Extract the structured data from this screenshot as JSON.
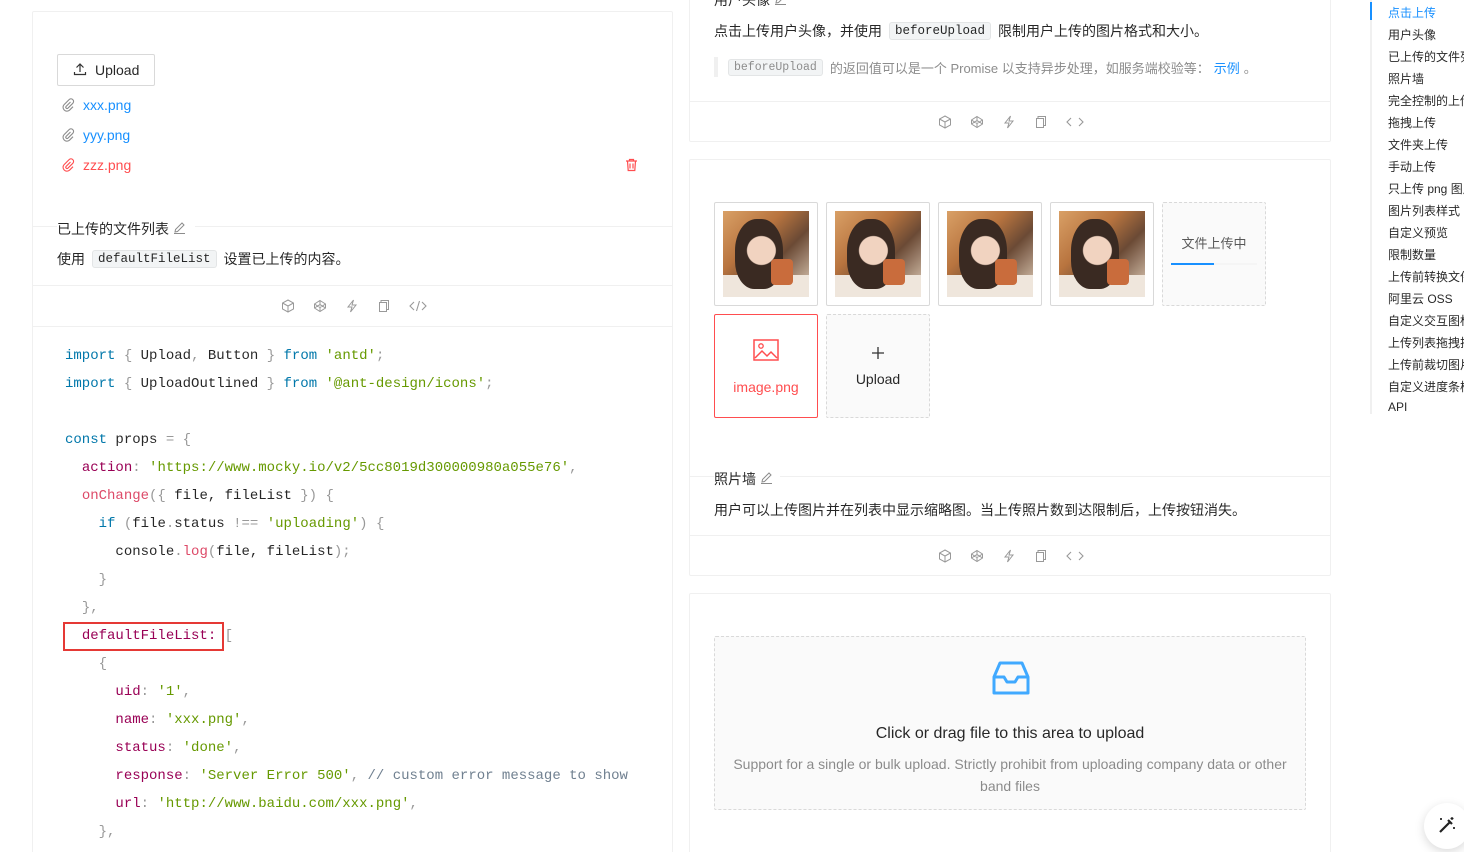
{
  "left_demo": {
    "upload_label": "Upload",
    "files": [
      {
        "name": "xxx.png",
        "status": "done"
      },
      {
        "name": "yyy.png",
        "status": "done"
      },
      {
        "name": "zzz.png",
        "status": "error"
      }
    ],
    "title": "已上传的文件列表",
    "desc_pre": "使用",
    "desc_code": "defaultFileList",
    "desc_post": "设置已上传的内容。"
  },
  "code": {
    "l1_kw": "import",
    "l1_mid": "Upload",
    "l1_mid2": "Button",
    "l1_from": "from",
    "l1_str": "'antd'",
    "l2_kw": "import",
    "l2_mid": "UploadOutlined",
    "l2_from": "from",
    "l2_str": "'@ant-design/icons'",
    "l4_kw": "const",
    "l4_name": "props",
    "action_key": "action",
    "action_val": "'https://www.mocky.io/v2/5cc8019d300000980a055e76'",
    "onchange_key": "onChange",
    "onchange_args": "file, fileList",
    "if_kw": "if",
    "if_cond_a": "file",
    "if_cond_b": "status",
    "if_str": "'uploading'",
    "console": "console",
    "log": "log",
    "log_args": "file, fileList",
    "dfl_key": "defaultFileList:",
    "uid_key": "uid",
    "uid_val": "'1'",
    "name_key": "name",
    "name_val": "'xxx.png'",
    "status_key": "status",
    "status_val": "'done'",
    "response_key": "response",
    "response_val": "'Server Error 500'",
    "response_comment": "// custom error message to show",
    "url_key": "url",
    "url_val": "'http://www.baidu.com/xxx.png'"
  },
  "avatar_demo": {
    "title": "用户头像",
    "desc_pre": "点击上传用户头像，并使用",
    "desc_code": "beforeUpload",
    "desc_post": "限制用户上传的图片格式和大小。",
    "note_code": "beforeUpload",
    "note_text": "的返回值可以是一个 Promise 以支持异步处理，如服务端校验等：",
    "note_link": "示例",
    "note_end": "。"
  },
  "picture_wall": {
    "uploading_label": "文件上传中",
    "error_file": "image.png",
    "upload_label": "Upload",
    "title": "照片墙",
    "desc": "用户可以上传图片并在列表中显示缩略图。当上传照片数到达限制后，上传按钮消失。"
  },
  "dragger": {
    "text": "Click or drag file to this area to upload",
    "hint_line1": "Support for a single or bulk upload. Strictly prohibit from uploading company data or other",
    "hint_line2": "band files"
  },
  "anchor": {
    "items": [
      "点击上传",
      "用户头像",
      "已上传的文件列表",
      "照片墙",
      "完全控制的上传列表",
      "拖拽上传",
      "文件夹上传",
      "手动上传",
      "只上传 png 图片",
      "图片列表样式",
      "自定义预览",
      "限制数量",
      "上传前转换文件",
      "阿里云 OSS",
      "自定义交互图标",
      "上传列表拖拽排序",
      "上传前裁切图片",
      "自定义进度条样式",
      "API"
    ],
    "active_index": 0
  },
  "colors": {
    "primary": "#1890ff",
    "error": "#ff4d4f",
    "highlight_box": "#e53935"
  }
}
